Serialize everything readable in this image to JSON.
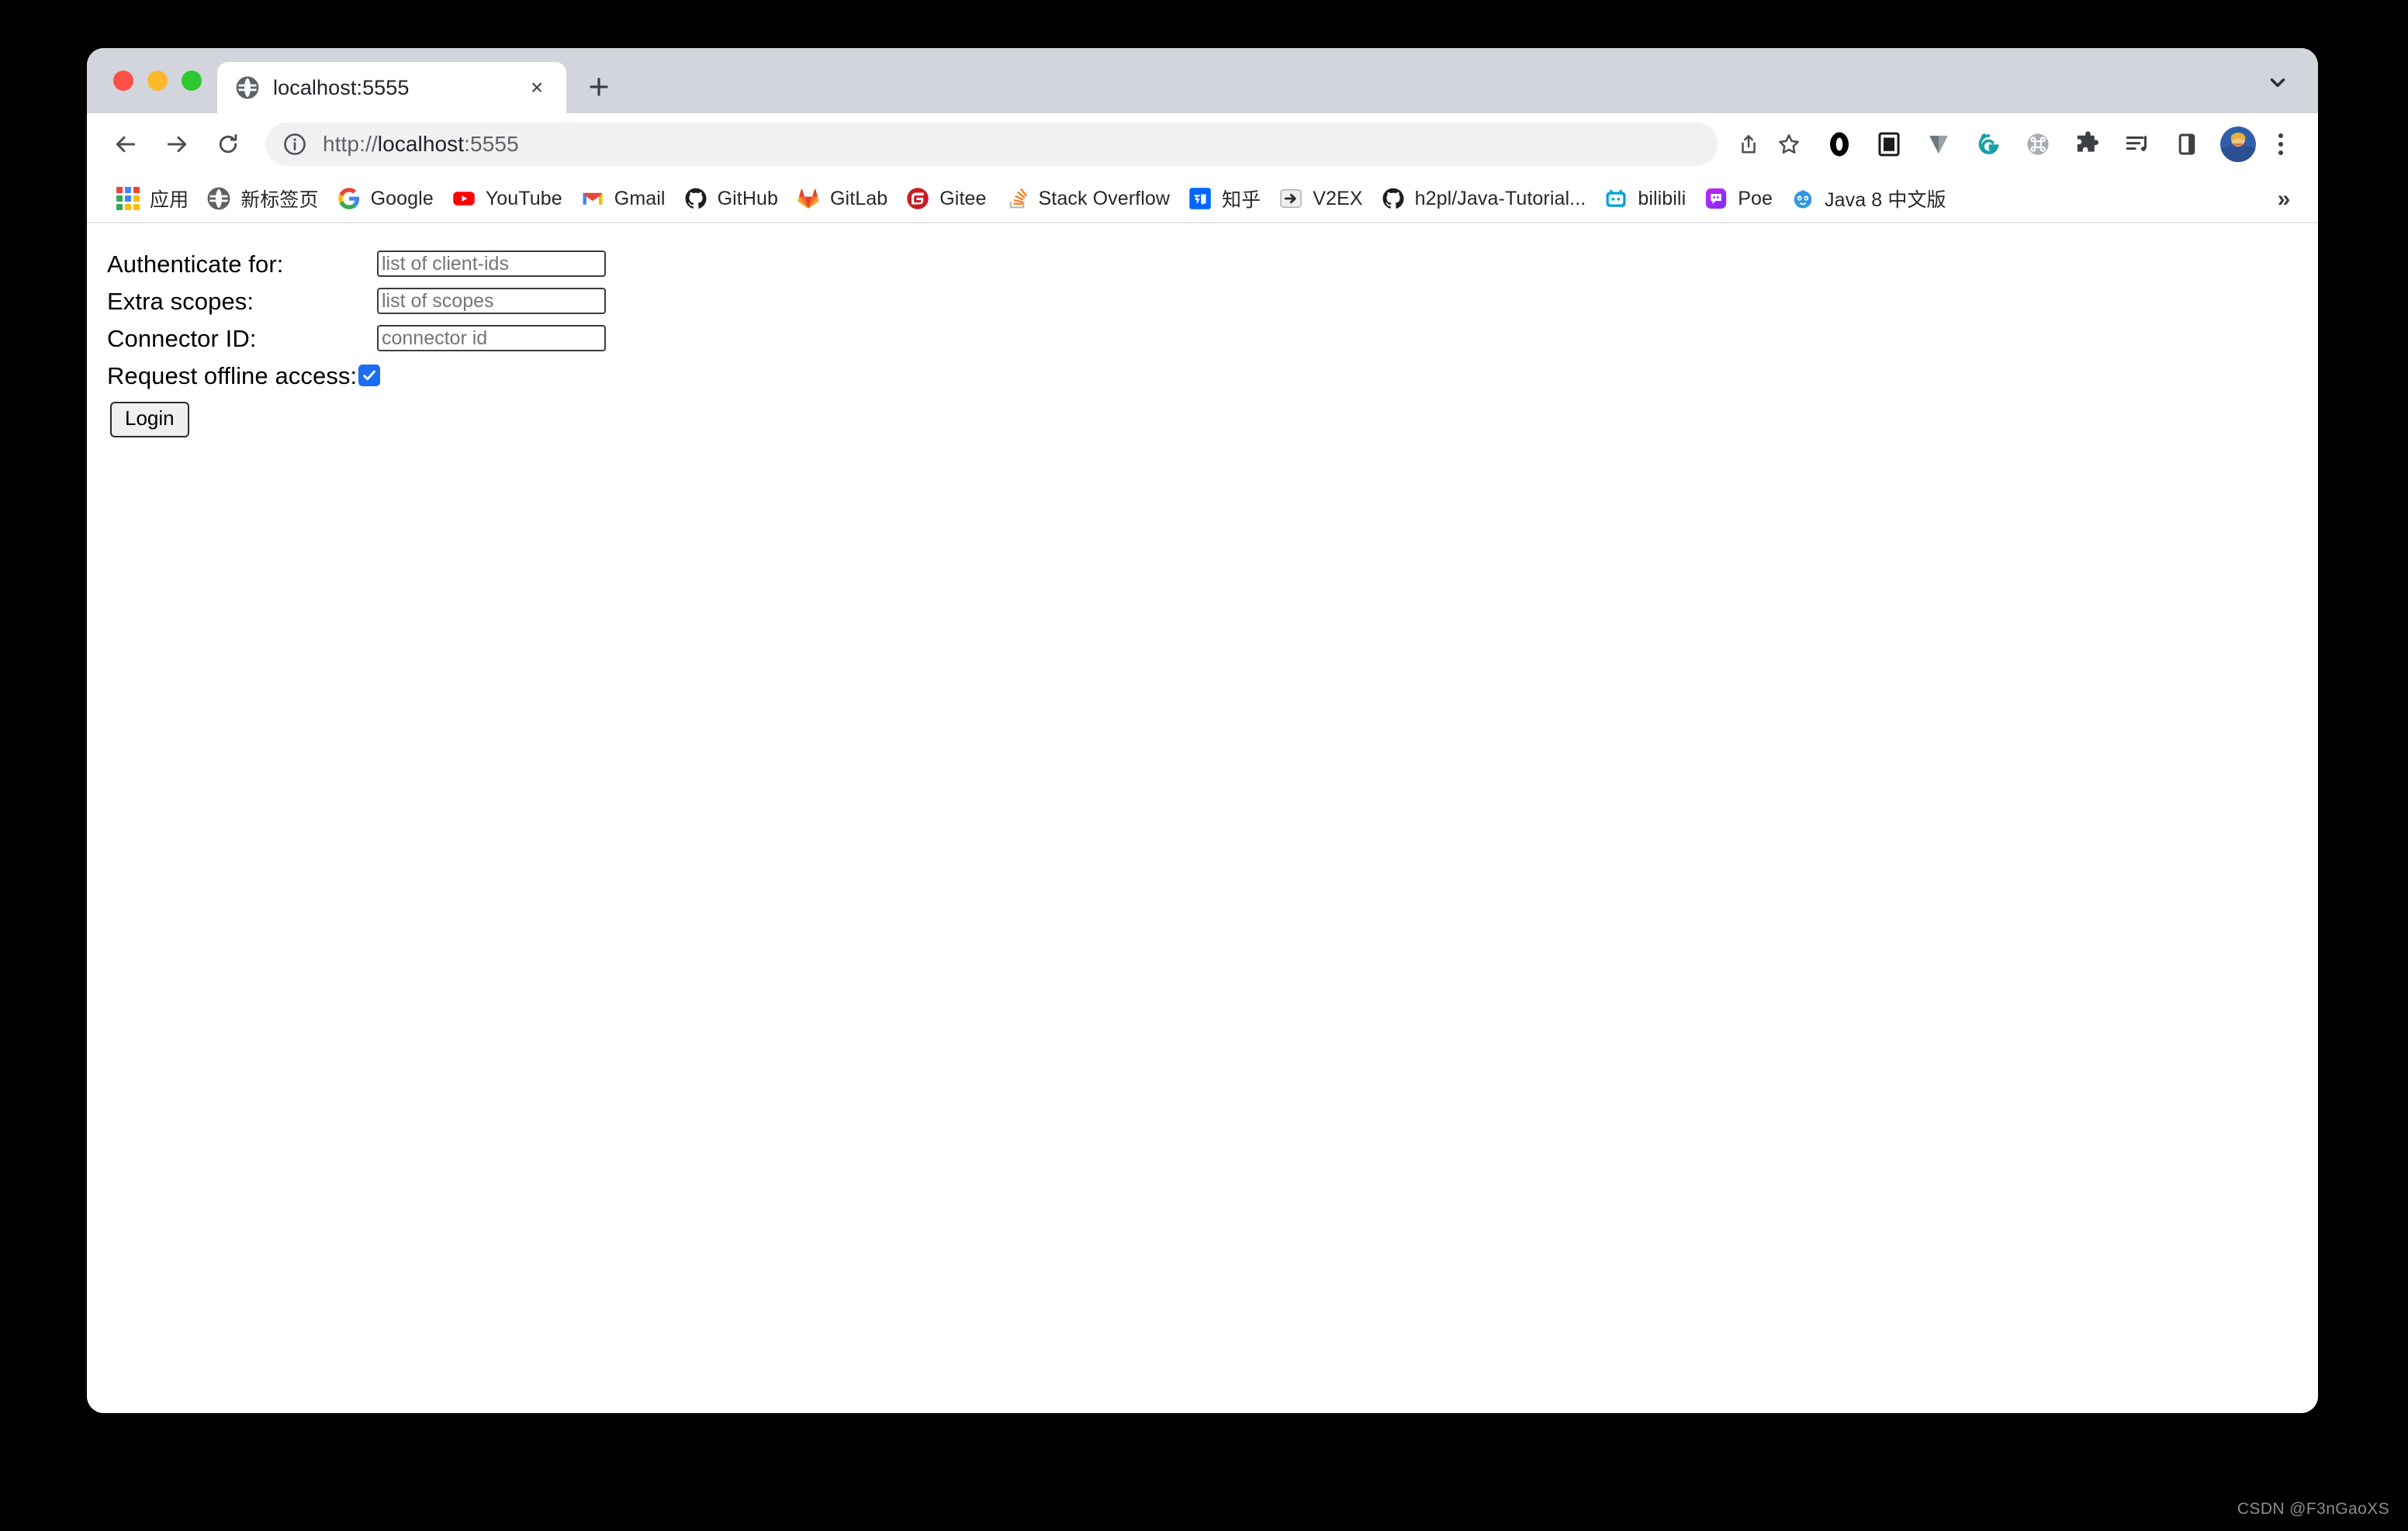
{
  "window": {
    "traffic_lights": [
      "close",
      "minimize",
      "maximize"
    ]
  },
  "tab_strip": {
    "tab": {
      "title": "localhost:5555",
      "favicon": "globe-icon",
      "close_label": "×"
    },
    "new_tab_label": "+",
    "tab_search_icon": "chevron-down-icon"
  },
  "toolbar": {
    "back_icon": "arrow-left-icon",
    "forward_icon": "arrow-right-icon",
    "reload_icon": "reload-icon",
    "omnibox": {
      "info_icon": "info-circle-icon",
      "url_scheme": "http://",
      "url_host": "localhost",
      "url_port": ":5555",
      "full_url": "http://localhost:5555"
    },
    "share_icon": "share-icon",
    "bookmark_icon": "star-icon",
    "extensions": [
      "opera-ring-icon",
      "screenshot-icon",
      "vimeo-v-icon",
      "grammarly-g-icon",
      "command-key-icon",
      "puzzle-extensions-icon",
      "media-playlist-icon",
      "side-panel-icon"
    ],
    "avatar": "user-avatar",
    "menu_icon": "three-dot-menu-icon"
  },
  "bookmarks": {
    "items": [
      {
        "label": "应用",
        "icon": "apps-grid-icon"
      },
      {
        "label": "新标签页",
        "icon": "globe-icon"
      },
      {
        "label": "Google",
        "icon": "google-g-icon"
      },
      {
        "label": "YouTube",
        "icon": "youtube-icon"
      },
      {
        "label": "Gmail",
        "icon": "gmail-icon"
      },
      {
        "label": "GitHub",
        "icon": "github-icon"
      },
      {
        "label": "GitLab",
        "icon": "gitlab-icon"
      },
      {
        "label": "Gitee",
        "icon": "gitee-icon"
      },
      {
        "label": "Stack Overflow",
        "icon": "stackoverflow-icon"
      },
      {
        "label": "知乎",
        "icon": "zhihu-icon"
      },
      {
        "label": "V2EX",
        "icon": "v2ex-icon"
      },
      {
        "label": "h2pl/Java-Tutorial...",
        "icon": "github-icon"
      },
      {
        "label": "bilibili",
        "icon": "bilibili-icon"
      },
      {
        "label": "Poe",
        "icon": "poe-icon"
      },
      {
        "label": "Java 8 中文版",
        "icon": "java8-cn-icon"
      }
    ],
    "overflow_label": "»"
  },
  "page": {
    "fields": [
      {
        "label": "Authenticate for:",
        "placeholder": "list of client-ids",
        "value": "",
        "name": "authenticate-for-input"
      },
      {
        "label": "Extra scopes:",
        "placeholder": "list of scopes",
        "value": "",
        "name": "extra-scopes-input"
      },
      {
        "label": "Connector ID:",
        "placeholder": "connector id",
        "value": "",
        "name": "connector-id-input"
      }
    ],
    "offline_access": {
      "label": "Request offline access:",
      "checked": true,
      "check_glyph": "✔"
    },
    "login_button": "Login"
  },
  "watermark": "CSDN @F3nGaoXS",
  "colors": {
    "chrome_header": "#d2d5dc",
    "omnibox_bg": "#eff1f3",
    "checkbox_blue": "#1b6ef3",
    "page_bg": "#ffffff",
    "desktop_bg": "#000000"
  }
}
